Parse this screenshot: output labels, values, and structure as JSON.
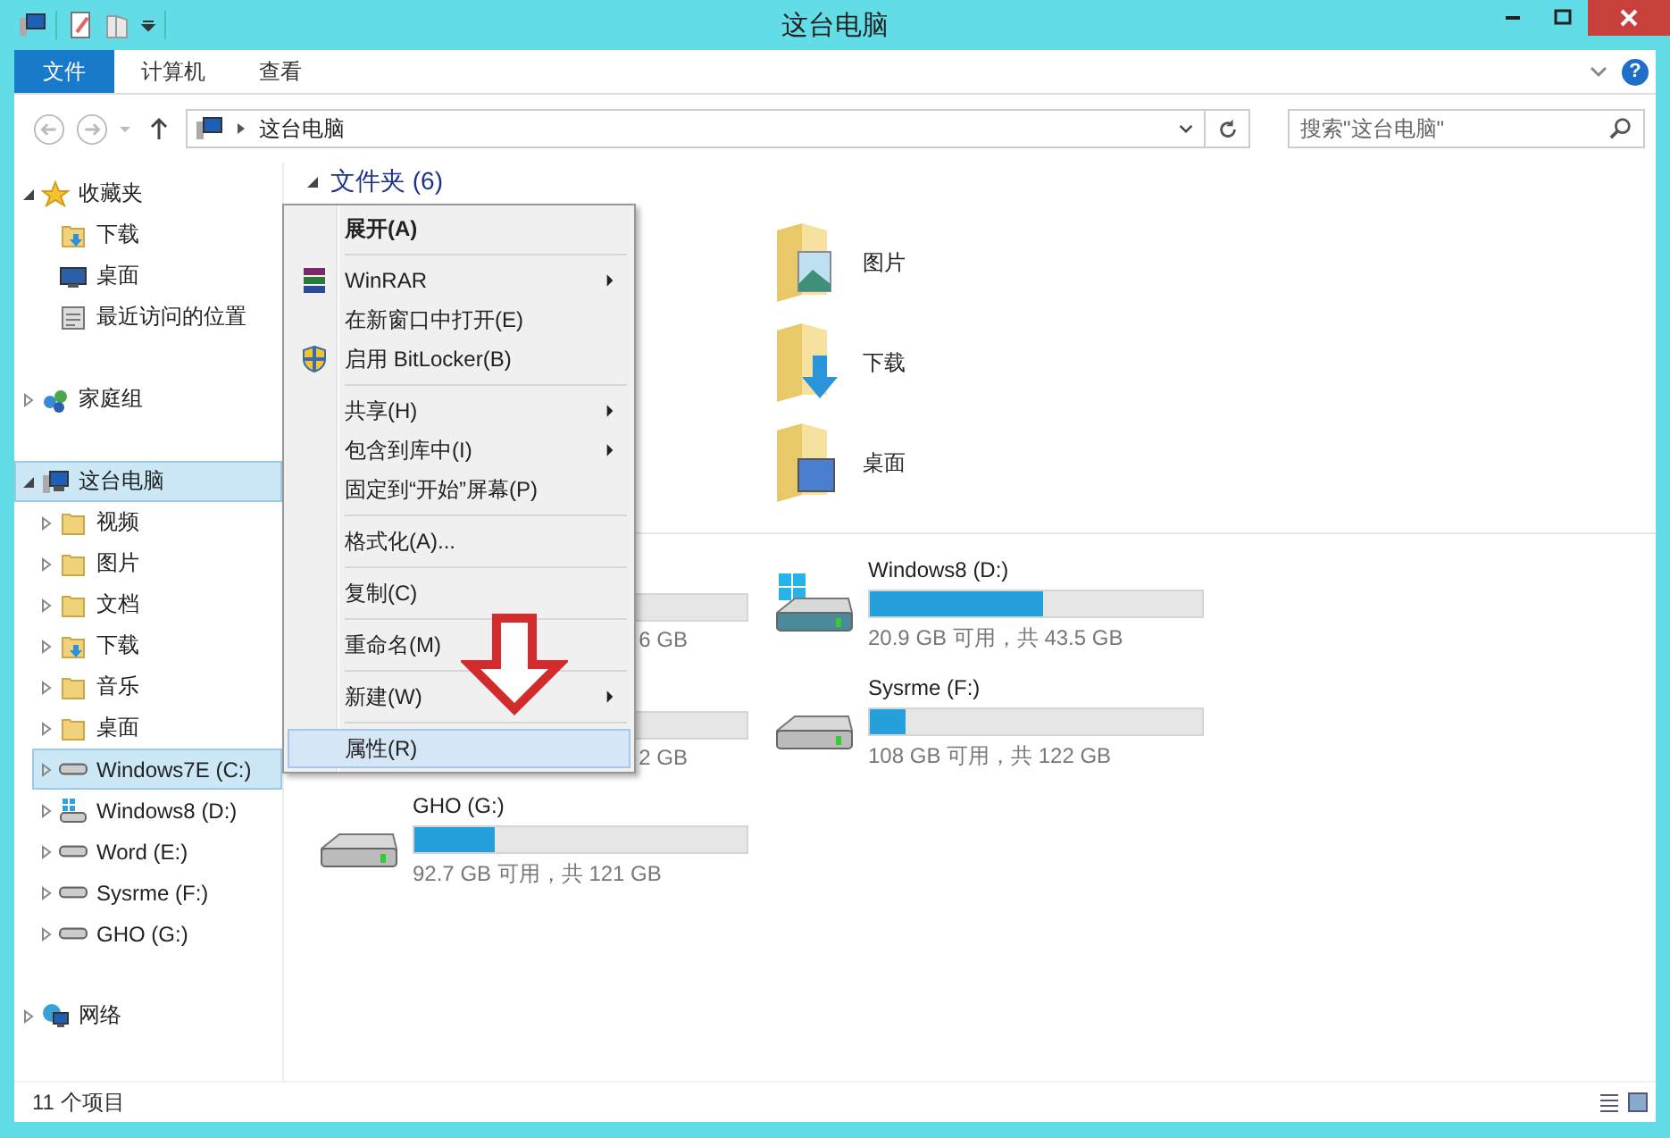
{
  "window": {
    "title": "这台电脑"
  },
  "ribbon": {
    "tabs": [
      {
        "label": "文件",
        "selected": true
      },
      {
        "label": "计算机",
        "selected": false
      },
      {
        "label": "查看",
        "selected": false
      }
    ],
    "help": "?"
  },
  "address": {
    "path": "这台电脑"
  },
  "search": {
    "placeholder": "搜索\"这台电脑\""
  },
  "nav": [
    {
      "label": "收藏夹",
      "kind": "star",
      "expanded": true,
      "selected": false,
      "children": [
        {
          "label": "下载",
          "kind": "download-folder",
          "selected": false
        },
        {
          "label": "桌面",
          "kind": "desktop",
          "selected": false
        },
        {
          "label": "最近访问的位置",
          "kind": "recent",
          "selected": false
        }
      ]
    },
    {
      "label": "家庭组",
      "kind": "homegroup",
      "expanded": false,
      "selected": false
    },
    {
      "label": "这台电脑",
      "kind": "computer",
      "expanded": true,
      "selected": true,
      "children": [
        {
          "label": "视频",
          "kind": "folder",
          "expanded": false,
          "selected": false
        },
        {
          "label": "图片",
          "kind": "folder",
          "expanded": false,
          "selected": false
        },
        {
          "label": "文档",
          "kind": "folder",
          "expanded": false,
          "selected": false
        },
        {
          "label": "下载",
          "kind": "download-folder",
          "expanded": false,
          "selected": false
        },
        {
          "label": "音乐",
          "kind": "folder",
          "expanded": false,
          "selected": false
        },
        {
          "label": "桌面",
          "kind": "folder",
          "expanded": false,
          "selected": false
        },
        {
          "label": "Windows7E (C:)",
          "kind": "drive",
          "expanded": false,
          "selected": true
        },
        {
          "label": "Windows8 (D:)",
          "kind": "windows-drive",
          "expanded": false,
          "selected": false
        },
        {
          "label": "Word (E:)",
          "kind": "drive",
          "expanded": false,
          "selected": false
        },
        {
          "label": "Sysrme (F:)",
          "kind": "drive",
          "expanded": false,
          "selected": false
        },
        {
          "label": "GHO (G:)",
          "kind": "drive",
          "expanded": false,
          "selected": false
        }
      ]
    },
    {
      "label": "网络",
      "kind": "network",
      "expanded": false,
      "selected": false
    }
  ],
  "content": {
    "folders_header": "文件夹 (6)",
    "folders": [
      {
        "label": "图片",
        "kind": "pictures"
      },
      {
        "label": "下载",
        "kind": "downloads"
      },
      {
        "label": "桌面",
        "kind": "desktop"
      }
    ],
    "drives": [
      {
        "kind": "covered",
        "caption": "6 GB"
      },
      {
        "kind": "full",
        "windows": true,
        "name": "Windows8 (D:)",
        "level": 0.52,
        "caption": "20.9 GB 可用，共 43.5 GB"
      },
      {
        "kind": "covered",
        "caption": "2 GB"
      },
      {
        "kind": "full",
        "windows": false,
        "name": "Sysrme (F:)",
        "level": 0.11,
        "caption": "108 GB 可用，共 122 GB"
      },
      {
        "kind": "full",
        "windows": false,
        "name": "GHO (G:)",
        "level": 0.24,
        "caption": "92.7 GB 可用，共 121 GB"
      }
    ]
  },
  "context_menu": [
    [
      {
        "label": "展开(A)",
        "bold": true,
        "submenu": false,
        "kind": "plain",
        "selected": false
      }
    ],
    [
      {
        "label": "WinRAR",
        "bold": false,
        "submenu": true,
        "kind": "archiver",
        "selected": false
      },
      {
        "label": "在新窗口中打开(E)",
        "bold": false,
        "submenu": false,
        "kind": "plain",
        "selected": false
      },
      {
        "label": "启用 BitLocker(B)",
        "bold": false,
        "submenu": false,
        "kind": "security",
        "selected": false
      }
    ],
    [
      {
        "label": "共享(H)",
        "bold": false,
        "submenu": true,
        "kind": "plain",
        "selected": false
      },
      {
        "label": "包含到库中(I)",
        "bold": false,
        "submenu": true,
        "kind": "plain",
        "selected": false
      },
      {
        "label": "固定到“开始”屏幕(P)",
        "bold": false,
        "submenu": false,
        "kind": "plain",
        "selected": false
      }
    ],
    [
      {
        "label": "格式化(A)...",
        "bold": false,
        "submenu": false,
        "kind": "plain",
        "selected": false
      }
    ],
    [
      {
        "label": "复制(C)",
        "bold": false,
        "submenu": false,
        "kind": "plain",
        "selected": false
      }
    ],
    [
      {
        "label": "重命名(M)",
        "bold": false,
        "submenu": false,
        "kind": "plain",
        "selected": false
      }
    ],
    [
      {
        "label": "新建(W)",
        "bold": false,
        "submenu": true,
        "kind": "plain",
        "selected": false
      }
    ],
    [
      {
        "label": "属性(R)",
        "bold": false,
        "submenu": false,
        "kind": "plain",
        "selected": true
      }
    ]
  ],
  "status_bar": {
    "count": "11 个项目"
  }
}
